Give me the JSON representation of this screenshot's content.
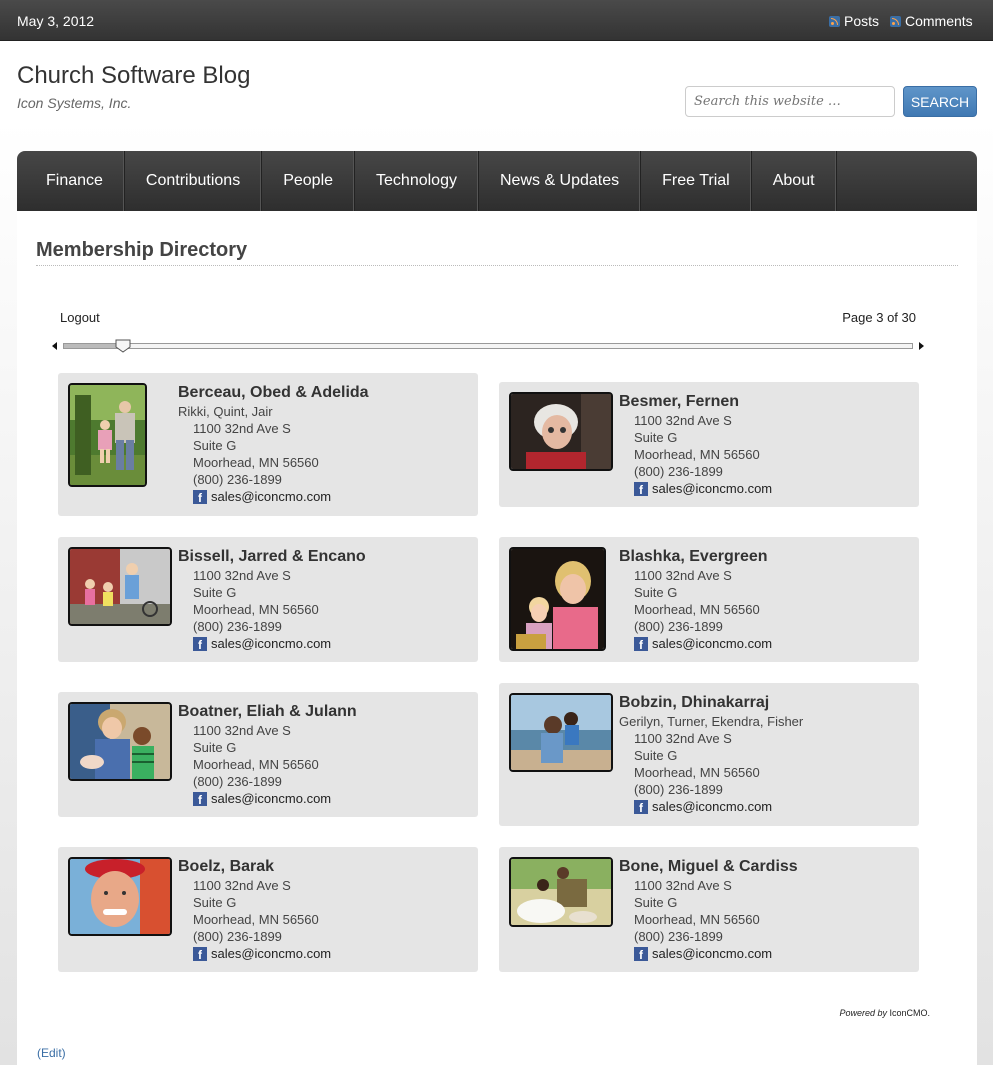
{
  "topbar": {
    "date": "May 3, 2012",
    "posts_label": "Posts",
    "comments_label": "Comments",
    "rss_icon": "rss-icon"
  },
  "header": {
    "title": "Church Software Blog",
    "description": "Icon Systems, Inc.",
    "search_placeholder": "Search this website …",
    "search_button": "SEARCH"
  },
  "nav": {
    "items": [
      "Finance",
      "Contributions",
      "People",
      "Technology",
      "News & Updates",
      "Free Trial",
      "About"
    ]
  },
  "page": {
    "title": "Membership Directory",
    "logout": "Logout",
    "pagination": "Page 3 of 30",
    "slider_position": 0.07,
    "powered_prefix": "Powered by",
    "powered_brand": "IconCMO.",
    "edit": "(Edit)"
  },
  "members": [
    {
      "name": "Berceau, Obed & Adelida",
      "children": "Rikki, Quint, Jair",
      "address1": "1100 32nd Ave S",
      "address2": "Suite G",
      "city": "Moorhead, MN 56560",
      "phone": "(800) 236-1899",
      "email": "sales@iconcmo.com"
    },
    {
      "name": "Besmer, Fernen",
      "children": "",
      "address1": "1100 32nd Ave S",
      "address2": "Suite G",
      "city": "Moorhead, MN 56560",
      "phone": "(800) 236-1899",
      "email": "sales@iconcmo.com"
    },
    {
      "name": "Bissell, Jarred & Encano",
      "children": "",
      "address1": "1100 32nd Ave S",
      "address2": "Suite G",
      "city": "Moorhead, MN 56560",
      "phone": "(800) 236-1899",
      "email": "sales@iconcmo.com"
    },
    {
      "name": "Blashka, Evergreen",
      "children": "",
      "address1": "1100 32nd Ave S",
      "address2": "Suite G",
      "city": "Moorhead, MN 56560",
      "phone": "(800) 236-1899",
      "email": "sales@iconcmo.com"
    },
    {
      "name": "Boatner, Eliah & Julann",
      "children": "",
      "address1": "1100 32nd Ave S",
      "address2": "Suite G",
      "city": "Moorhead, MN 56560",
      "phone": "(800) 236-1899",
      "email": "sales@iconcmo.com"
    },
    {
      "name": "Bobzin, Dhinakarraj",
      "children": "Gerilyn, Turner, Ekendra, Fisher",
      "address1": "1100 32nd Ave S",
      "address2": "Suite G",
      "city": "Moorhead, MN 56560",
      "phone": "(800) 236-1899",
      "email": "sales@iconcmo.com"
    },
    {
      "name": "Boelz, Barak",
      "children": "",
      "address1": "1100 32nd Ave S",
      "address2": "Suite G",
      "city": "Moorhead, MN 56560",
      "phone": "(800) 236-1899",
      "email": "sales@iconcmo.com"
    },
    {
      "name": "Bone, Miguel & Cardiss",
      "children": "",
      "address1": "1100 32nd Ave S",
      "address2": "Suite G",
      "city": "Moorhead, MN 56560",
      "phone": "(800) 236-1899",
      "email": "sales@iconcmo.com"
    }
  ],
  "colors": {
    "accent": "#4a80b8",
    "facebook": "#3b5998",
    "card_bg": "#e5e5e5",
    "nav_bg": "#3a3a3a"
  }
}
